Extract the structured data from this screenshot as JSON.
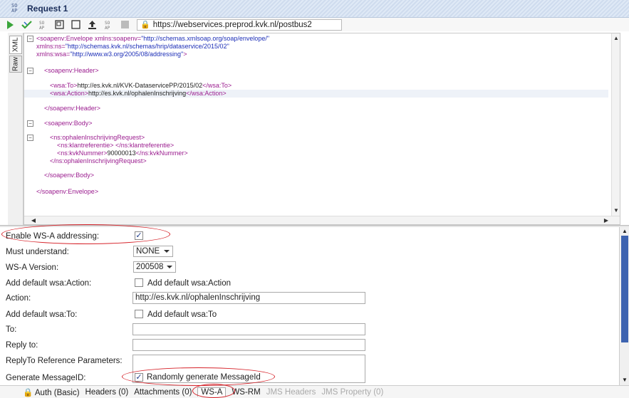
{
  "window": {
    "title": "Request 1",
    "app_icon_text": "SO AP"
  },
  "toolbar": {
    "icons": [
      "run-icon",
      "validate-icon",
      "soap-icon",
      "restore-icon",
      "maximize-icon",
      "upload-icon",
      "wsdl-icon",
      "stop-icon"
    ],
    "url": "https://webservices.preprod.kvk.nl/postbus2"
  },
  "sidetabs": {
    "xml": "XML",
    "raw": "Raw"
  },
  "xml": {
    "l1_tag": "<soapenv:Envelope",
    "l1_attr": " xmlns:soapenv=",
    "l1_val": "\"http://schemas.xmlsoap.org/soap/envelope/\"",
    "l2_attr": "xmlns:ns=",
    "l2_val": "\"http://schemas.kvk.nl/schemas/hrip/dataservice/2015/02\"",
    "l3_attr": "xmlns:wsa=",
    "l3_val": "\"http://www.w3.org/2005/08/addressing\"",
    "l3_end": ">",
    "header_open": "<soapenv:Header>",
    "to_open": "<wsa:To>",
    "to_text": "http://es.kvk.nl/KVK-DataservicePP/2015/02",
    "to_close": "</wsa:To>",
    "action_open": "<wsa:Action>",
    "action_text": "http://es.kvk.nl/ophalenInschrijving",
    "action_close": "</wsa:Action>",
    "header_close": "</soapenv:Header>",
    "body_open": "<soapenv:Body>",
    "req_open": "<ns:ophalenInschrijvingRequest>",
    "klant": "<ns:klantreferentie> </ns:klantreferentie>",
    "kvk_open": "<ns:kvkNummer>",
    "kvk_text": "90000013",
    "kvk_close": "</ns:kvkNummer>",
    "req_close": "</ns:ophalenInschrijvingRequest>",
    "body_close": "</soapenv:Body>",
    "env_close": "</soapenv:Envelope>"
  },
  "wsa": {
    "enable_label": "Enable WS-A addressing:",
    "enable_checked": true,
    "must_understand_label": "Must understand:",
    "must_understand_value": "NONE",
    "version_label": "WS-A Version:",
    "version_value": "200508",
    "add_action_label": "Add default wsa:Action:",
    "add_action_check_label": "Add default wsa:Action",
    "action_label": "Action:",
    "action_value": "http://es.kvk.nl/ophalenInschrijving",
    "add_to_label": "Add default wsa:To:",
    "add_to_check_label": "Add default wsa:To",
    "to_label": "To:",
    "to_value": "",
    "reply_to_label": "Reply to:",
    "reply_to_value": "",
    "reply_params_label": "ReplyTo Reference Parameters:",
    "reply_params_value": "",
    "gen_msgid_label": "Generate MessageID:",
    "gen_msgid_check_label": "Randomly generate MessageId",
    "gen_msgid_checked": true
  },
  "bottom_tabs": {
    "auth": "Auth (Basic)",
    "headers": "Headers (0)",
    "attachments": "Attachments (0)",
    "wsa": "WS-A",
    "wsrm": "WS-RM",
    "jms_headers": "JMS Headers",
    "jms_property": "JMS Property (0)"
  },
  "colors": {
    "annotation": "#d6232a",
    "accent": "#3d63b0",
    "xml_tag": "#9b1d8f",
    "xml_value": "#1d2fb7"
  }
}
